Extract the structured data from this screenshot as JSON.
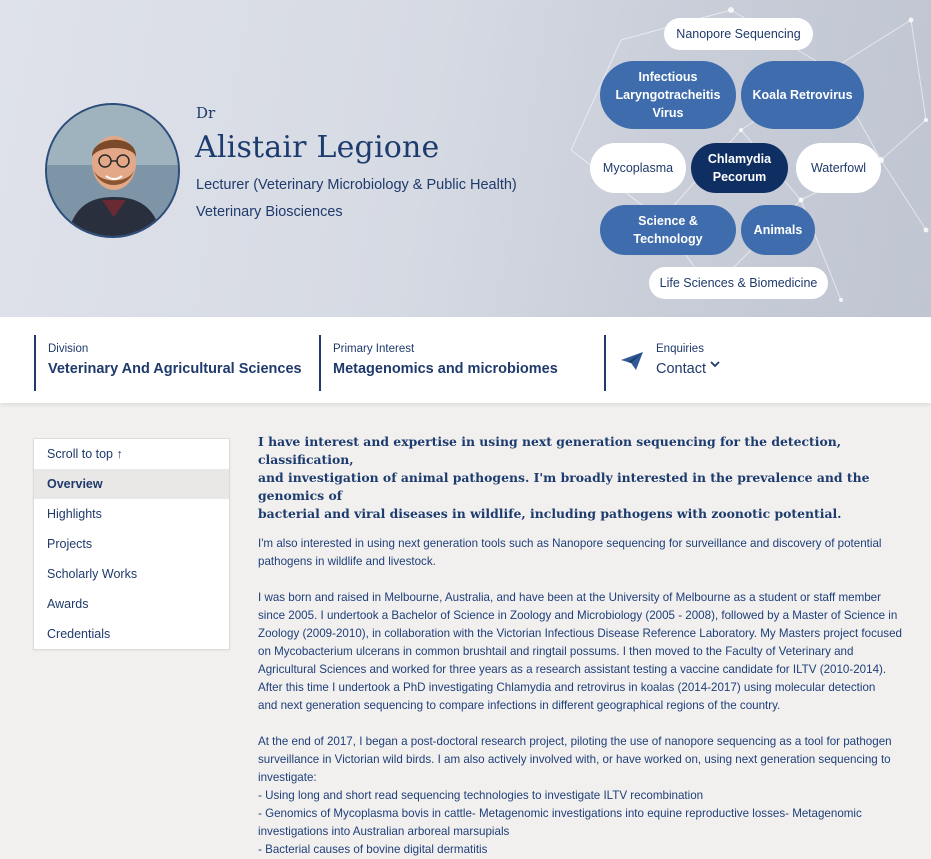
{
  "profile": {
    "honorific": "Dr",
    "name": "Alistair Legione",
    "role": "Lecturer (Veterinary Microbiology & Public Health)",
    "department": "Veterinary Biosciences"
  },
  "tags": [
    {
      "label": "Nanopore Sequencing",
      "style": "white"
    },
    {
      "label": "Infectious Laryngotracheitis Virus",
      "style": "mid"
    },
    {
      "label": "Koala Retrovirus",
      "style": "mid"
    },
    {
      "label": "Mycoplasma",
      "style": "white"
    },
    {
      "label": "Chlamydia Pecorum",
      "style": "dark"
    },
    {
      "label": "Waterfowl",
      "style": "white"
    },
    {
      "label": "Science & Technology",
      "style": "mid"
    },
    {
      "label": "Animals",
      "style": "mid"
    },
    {
      "label": "Life Sciences & Biomedicine",
      "style": "white"
    }
  ],
  "info": {
    "division_label": "Division",
    "division_value": "Veterinary And Agricultural Sciences",
    "interest_label": "Primary Interest",
    "interest_value": "Metagenomics and microbiomes",
    "enquiries_label": "Enquiries",
    "enquiries_value": "Contact"
  },
  "nav": {
    "items": [
      "Scroll to top ↑",
      "Overview",
      "Highlights",
      "Projects",
      "Scholarly Works",
      "Awards",
      "Credentials"
    ],
    "active": "Overview"
  },
  "overview": {
    "lead": [
      "I have interest and expertise in using next generation sequencing for the detection, classification,",
      "and investigation of animal pathogens. I'm broadly interested in the prevalence and the genomics of",
      "bacterial and viral diseases in wildlife, including pathogens with zoonotic potential."
    ],
    "paragraphs": [
      [
        "I'm also interested in using next generation tools such as Nanopore sequencing for surveillance and discovery of potential",
        "pathogens in wildlife and livestock."
      ],
      [
        "I was born and raised in Melbourne, Australia, and have been at the University of Melbourne as a student or staff member",
        "since 2005. I undertook a Bachelor of Science in Zoology and Microbiology (2005 - 2008), followed by a Master of Science in",
        "Zoology (2009-2010), in collaboration with the Victorian Infectious Disease Reference Laboratory. My Masters project focused",
        "on Mycobacterium ulcerans in common brushtail and ringtail possums. I then moved to the Faculty of Veterinary and",
        "Agricultural Sciences and worked for three years as a research assistant testing a vaccine candidate for ILTV (2010-2014).",
        "After this time I undertook a PhD investigating Chlamydia and retrovirus in koalas (2014-2017) using molecular detection",
        "and next generation sequencing to compare infections in different geographical regions of the country."
      ],
      [
        "At the end of 2017, I began a post-doctoral research project, piloting the use of nanopore sequencing as a tool for pathogen",
        "surveillance in Victorian wild birds. I am also actively involved with, or have worked on, using next generation sequencing to",
        "investigate:",
        "- Using long and short read sequencing technologies to investigate ILTV recombination",
        "- Genomics of Mycoplasma bovis in cattle- Metagenomic investigations into equine reproductive losses- Metagenomic",
        "investigations into Australian arboreal marsupials",
        "- Bacterial causes of bovine digital dermatitis"
      ]
    ]
  }
}
